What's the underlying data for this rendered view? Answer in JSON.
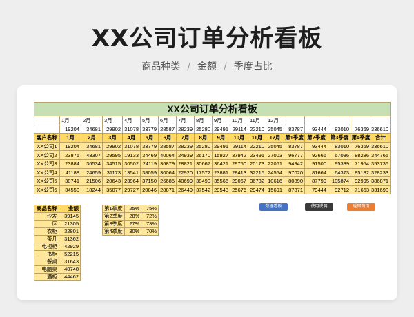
{
  "page": {
    "title": "XX公司订单分析看板",
    "subtitle": [
      "商品种类",
      "金额",
      "季度占比"
    ],
    "separator": "/"
  },
  "sheet": {
    "title": "XX公司订单分析看板",
    "month_labels": [
      "1月",
      "2月",
      "3月",
      "4月",
      "5月",
      "6月",
      "7月",
      "8月",
      "9月",
      "10月",
      "11月",
      "12月"
    ],
    "totals_row": [
      "19204",
      "34681",
      "29902",
      "31078",
      "33779",
      "28587",
      "28239",
      "25280",
      "29491",
      "29114",
      "22210",
      "25045",
      "83787",
      "93444",
      "83010",
      "76369",
      "336610"
    ],
    "header": [
      "客户名称",
      "1月",
      "2月",
      "3月",
      "4月",
      "5月",
      "6月",
      "7月",
      "8月",
      "9月",
      "10月",
      "11月",
      "12月",
      "第1季度",
      "第2季度",
      "第3季度",
      "第4季度",
      "合计"
    ],
    "rows": [
      [
        "XX公司1",
        "19204",
        "34681",
        "29902",
        "31078",
        "33779",
        "28587",
        "28239",
        "25280",
        "29491",
        "29114",
        "22210",
        "25045",
        "83787",
        "93444",
        "83010",
        "76369",
        "336610"
      ],
      [
        "XX公司2",
        "23875",
        "43307",
        "29595",
        "19133",
        "34469",
        "40064",
        "24939",
        "26170",
        "15927",
        "37942",
        "23491",
        "27003",
        "96777",
        "92666",
        "67036",
        "88286",
        "344765"
      ],
      [
        "XX公司3",
        "23884",
        "36534",
        "34515",
        "30502",
        "24119",
        "36879",
        "28821",
        "30667",
        "36421",
        "29750",
        "20173",
        "22061",
        "94942",
        "91500",
        "95339",
        "71954",
        "353735"
      ],
      [
        "XX公司4",
        "41188",
        "24659",
        "31173",
        "13541",
        "38059",
        "30064",
        "22920",
        "17572",
        "23881",
        "28413",
        "32215",
        "24554",
        "97020",
        "81664",
        "64373",
        "85182",
        "328233"
      ],
      [
        "XX公司5",
        "38741",
        "21506",
        "20643",
        "23964",
        "37150",
        "26685",
        "40699",
        "38490",
        "35566",
        "29067",
        "36732",
        "10616",
        "80890",
        "87799",
        "105874",
        "92995",
        "386871"
      ],
      [
        "XX公司6",
        "34550",
        "18244",
        "35077",
        "29727",
        "20846",
        "28871",
        "26449",
        "37542",
        "29543",
        "25676",
        "29474",
        "15691",
        "87871",
        "79444",
        "92712",
        "71663",
        "331690"
      ]
    ],
    "categories": {
      "header": [
        "商品名称",
        "金额"
      ],
      "rows": [
        [
          "沙发",
          "39145"
        ],
        [
          "床",
          "21305"
        ],
        [
          "衣柜",
          "32801"
        ],
        [
          "茶几",
          "31362"
        ],
        [
          "电视柜",
          "42929"
        ],
        [
          "书柜",
          "52215"
        ],
        [
          "餐桌",
          "31643"
        ],
        [
          "电脑桌",
          "40748"
        ],
        [
          "酒柜",
          "44462"
        ]
      ]
    },
    "quarters": [
      [
        "第1季度",
        "25%",
        "75%"
      ],
      [
        "第2季度",
        "28%",
        "72%"
      ],
      [
        "第3季度",
        "27%",
        "73%"
      ],
      [
        "第4季度",
        "30%",
        "70%"
      ]
    ],
    "buttons": {
      "data_board": "数据看板",
      "instructions": "使用说明",
      "home": "返回首页"
    },
    "colors": {
      "title_fill": "#c6e0b4",
      "header_fill": "#ffd966",
      "data_fill": "#ffe699",
      "btn_blue": "#4472c4",
      "btn_dark": "#3a3a3a",
      "btn_orange": "#ed7d31"
    }
  }
}
